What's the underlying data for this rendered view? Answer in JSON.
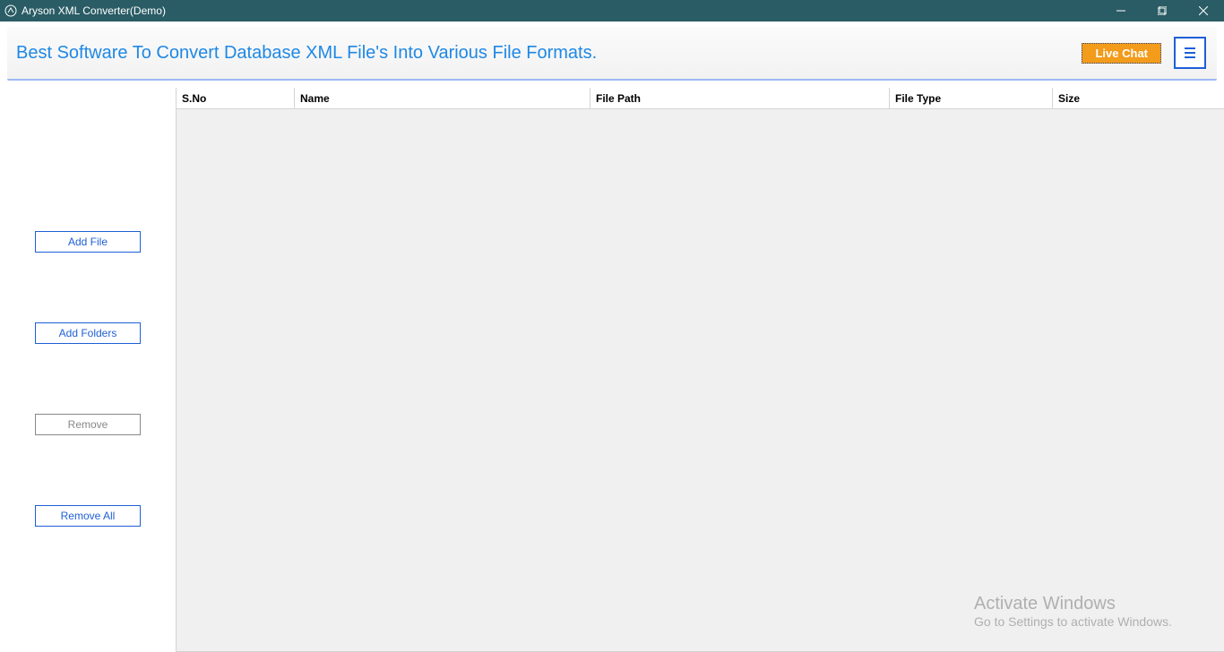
{
  "titlebar": {
    "title": "Aryson XML Converter(Demo)"
  },
  "header": {
    "headline": "Best Software To Convert Database XML File's Into Various File Formats.",
    "live_chat": "Live Chat"
  },
  "sidebar": {
    "add_file": "Add File",
    "add_folders": "Add Folders",
    "remove": "Remove",
    "remove_all": "Remove All"
  },
  "table": {
    "columns": {
      "sno": "S.No",
      "name": "Name",
      "path": "File Path",
      "type": "File Type",
      "size": "Size"
    },
    "rows": []
  },
  "watermark": {
    "title": "Activate Windows",
    "subtitle": "Go to Settings to activate Windows."
  }
}
